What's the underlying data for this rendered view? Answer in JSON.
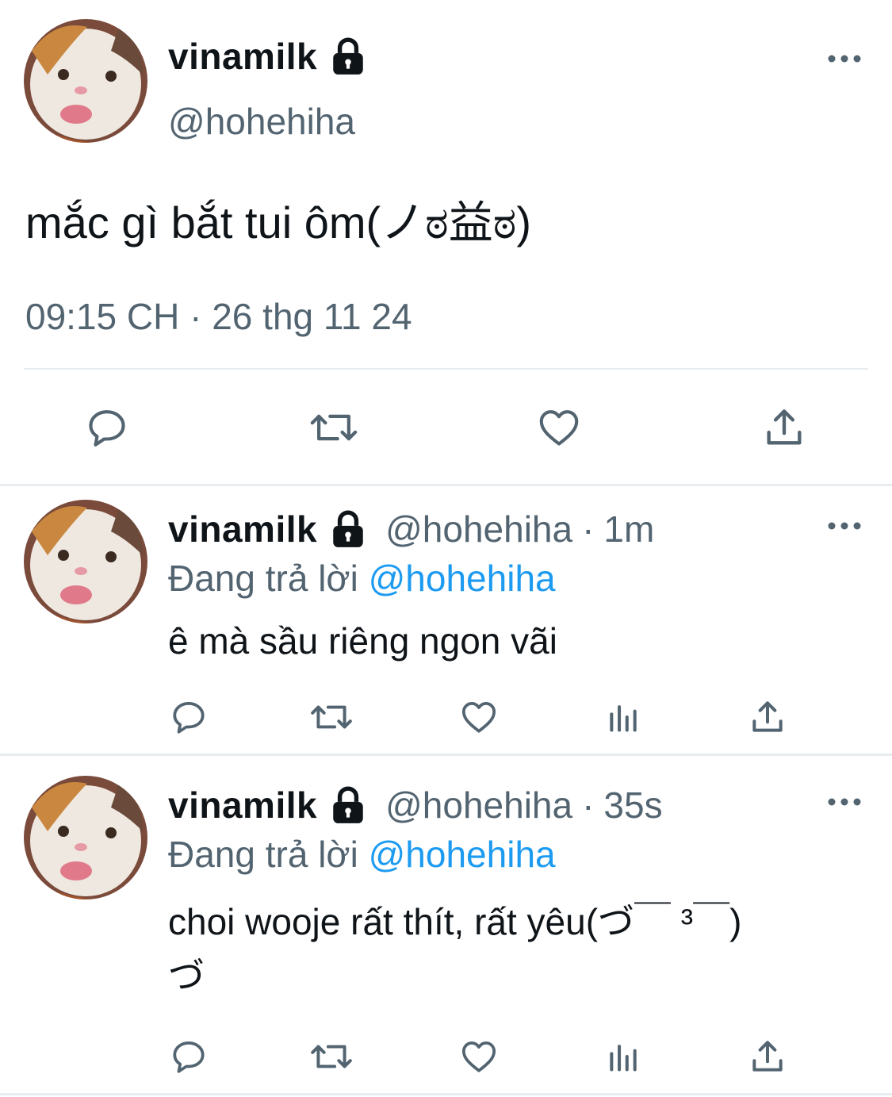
{
  "main_tweet": {
    "display_name": "vinamilk",
    "handle": "@hohehiha",
    "text": "mắc gì bắt tui ôm(ノಠ益ಠ)",
    "timestamp": "09:15 CH · 26 thg 11 24",
    "icons": [
      "avatar",
      "lock-icon",
      "more-icon",
      "reply-icon",
      "retweet-icon",
      "like-icon",
      "share-icon"
    ]
  },
  "replies": [
    {
      "display_name": "vinamilk",
      "handle": "@hohehiha",
      "dot": "·",
      "time": "1m",
      "replying_prefix": "Đang trả lời",
      "replying_to": "@hohehiha",
      "text": "ê mà sầu riêng ngon vãi"
    },
    {
      "display_name": "vinamilk",
      "handle": "@hohehiha",
      "dot": "·",
      "time": "35s",
      "replying_prefix": "Đang trả lời",
      "replying_to": "@hohehiha",
      "text_line1": "choi wooje rất thít, rất yêu(づ￣ ³￣)",
      "text_line2": "づ"
    }
  ],
  "colors": {
    "text": "#0f1419",
    "secondary": "#536471",
    "accent": "#1d9bf0",
    "divider": "#e6ecf0"
  }
}
